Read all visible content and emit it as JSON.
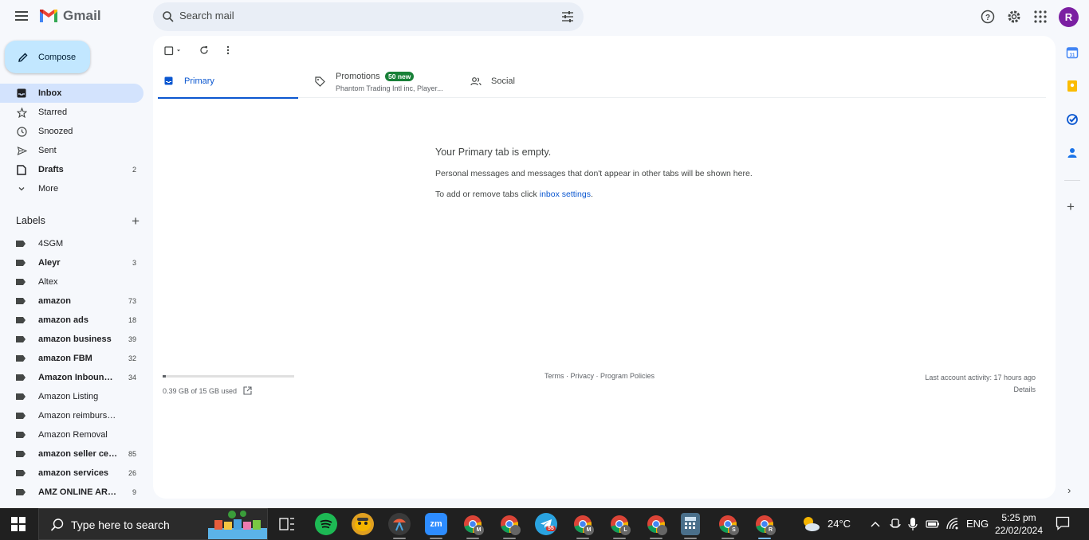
{
  "app": {
    "name": "Gmail"
  },
  "search": {
    "placeholder": "Search mail"
  },
  "account": {
    "initial": "R"
  },
  "compose_label": "Compose",
  "nav": [
    {
      "label": "Inbox",
      "icon": "inbox-icon",
      "count": "",
      "active": true,
      "bold": true
    },
    {
      "label": "Starred",
      "icon": "star-icon",
      "count": "",
      "active": false,
      "bold": false
    },
    {
      "label": "Snoozed",
      "icon": "clock-icon",
      "count": "",
      "active": false,
      "bold": false
    },
    {
      "label": "Sent",
      "icon": "send-icon",
      "count": "",
      "active": false,
      "bold": false
    },
    {
      "label": "Drafts",
      "icon": "draft-icon",
      "count": "2",
      "active": false,
      "bold": true
    },
    {
      "label": "More",
      "icon": "chevron-down-icon",
      "count": "",
      "active": false,
      "bold": false
    }
  ],
  "labels_title": "Labels",
  "labels": [
    {
      "name": "4SGM",
      "count": "",
      "bold": false
    },
    {
      "name": "Aleyr",
      "count": "3",
      "bold": true
    },
    {
      "name": "Altex",
      "count": "",
      "bold": false
    },
    {
      "name": "amazon",
      "count": "73",
      "bold": true
    },
    {
      "name": "amazon ads",
      "count": "18",
      "bold": true
    },
    {
      "name": "amazon business",
      "count": "39",
      "bold": true
    },
    {
      "name": "amazon FBM",
      "count": "32",
      "bold": true
    },
    {
      "name": "Amazon Inbound ...",
      "count": "34",
      "bold": true
    },
    {
      "name": "Amazon Listing",
      "count": "",
      "bold": false
    },
    {
      "name": "Amazon reimbursement",
      "count": "",
      "bold": false
    },
    {
      "name": "Amazon Removal",
      "count": "",
      "bold": false
    },
    {
      "name": "amazon seller cen...",
      "count": "85",
      "bold": true
    },
    {
      "name": "amazon services",
      "count": "26",
      "bold": true
    },
    {
      "name": "AMZ ONLINE ARBI...",
      "count": "9",
      "bold": true
    }
  ],
  "tabs": [
    {
      "label": "Primary",
      "icon": "inbox-tab-icon",
      "active": true
    },
    {
      "label": "Promotions",
      "icon": "tag-icon",
      "badge": "50 new",
      "subtitle": "Phantom Trading Intl inc, Player..."
    },
    {
      "label": "Social",
      "icon": "people-icon"
    }
  ],
  "empty": {
    "title": "Your Primary tab is empty.",
    "line1": "Personal messages and messages that don't appear in other tabs will be shown here.",
    "line2_prefix": "To add or remove tabs click ",
    "line2_link": "inbox settings",
    "line2_suffix": "."
  },
  "storage": {
    "text": "0.39 GB of 15 GB used",
    "fraction": 0.026
  },
  "footer": {
    "terms": "Terms",
    "privacy": "Privacy",
    "policies": "Program Policies",
    "sep": " · ",
    "activity": "Last account activity: 17 hours ago",
    "details": "Details"
  },
  "taskbar": {
    "search_text": "Type here to search",
    "weather": "24°C",
    "lang": "ENG",
    "time": "5:25 pm",
    "date": "22/02/2024",
    "telegram_badge": "55",
    "profile_letters": [
      "M",
      "",
      "M",
      "L",
      "",
      "S",
      "R"
    ]
  },
  "colors": {
    "accent": "#0b57d0",
    "compose_bg": "#c2e7ff",
    "active_nav": "#d3e3fd",
    "badge_green": "#188038",
    "avatar": "#7b1fa2"
  }
}
